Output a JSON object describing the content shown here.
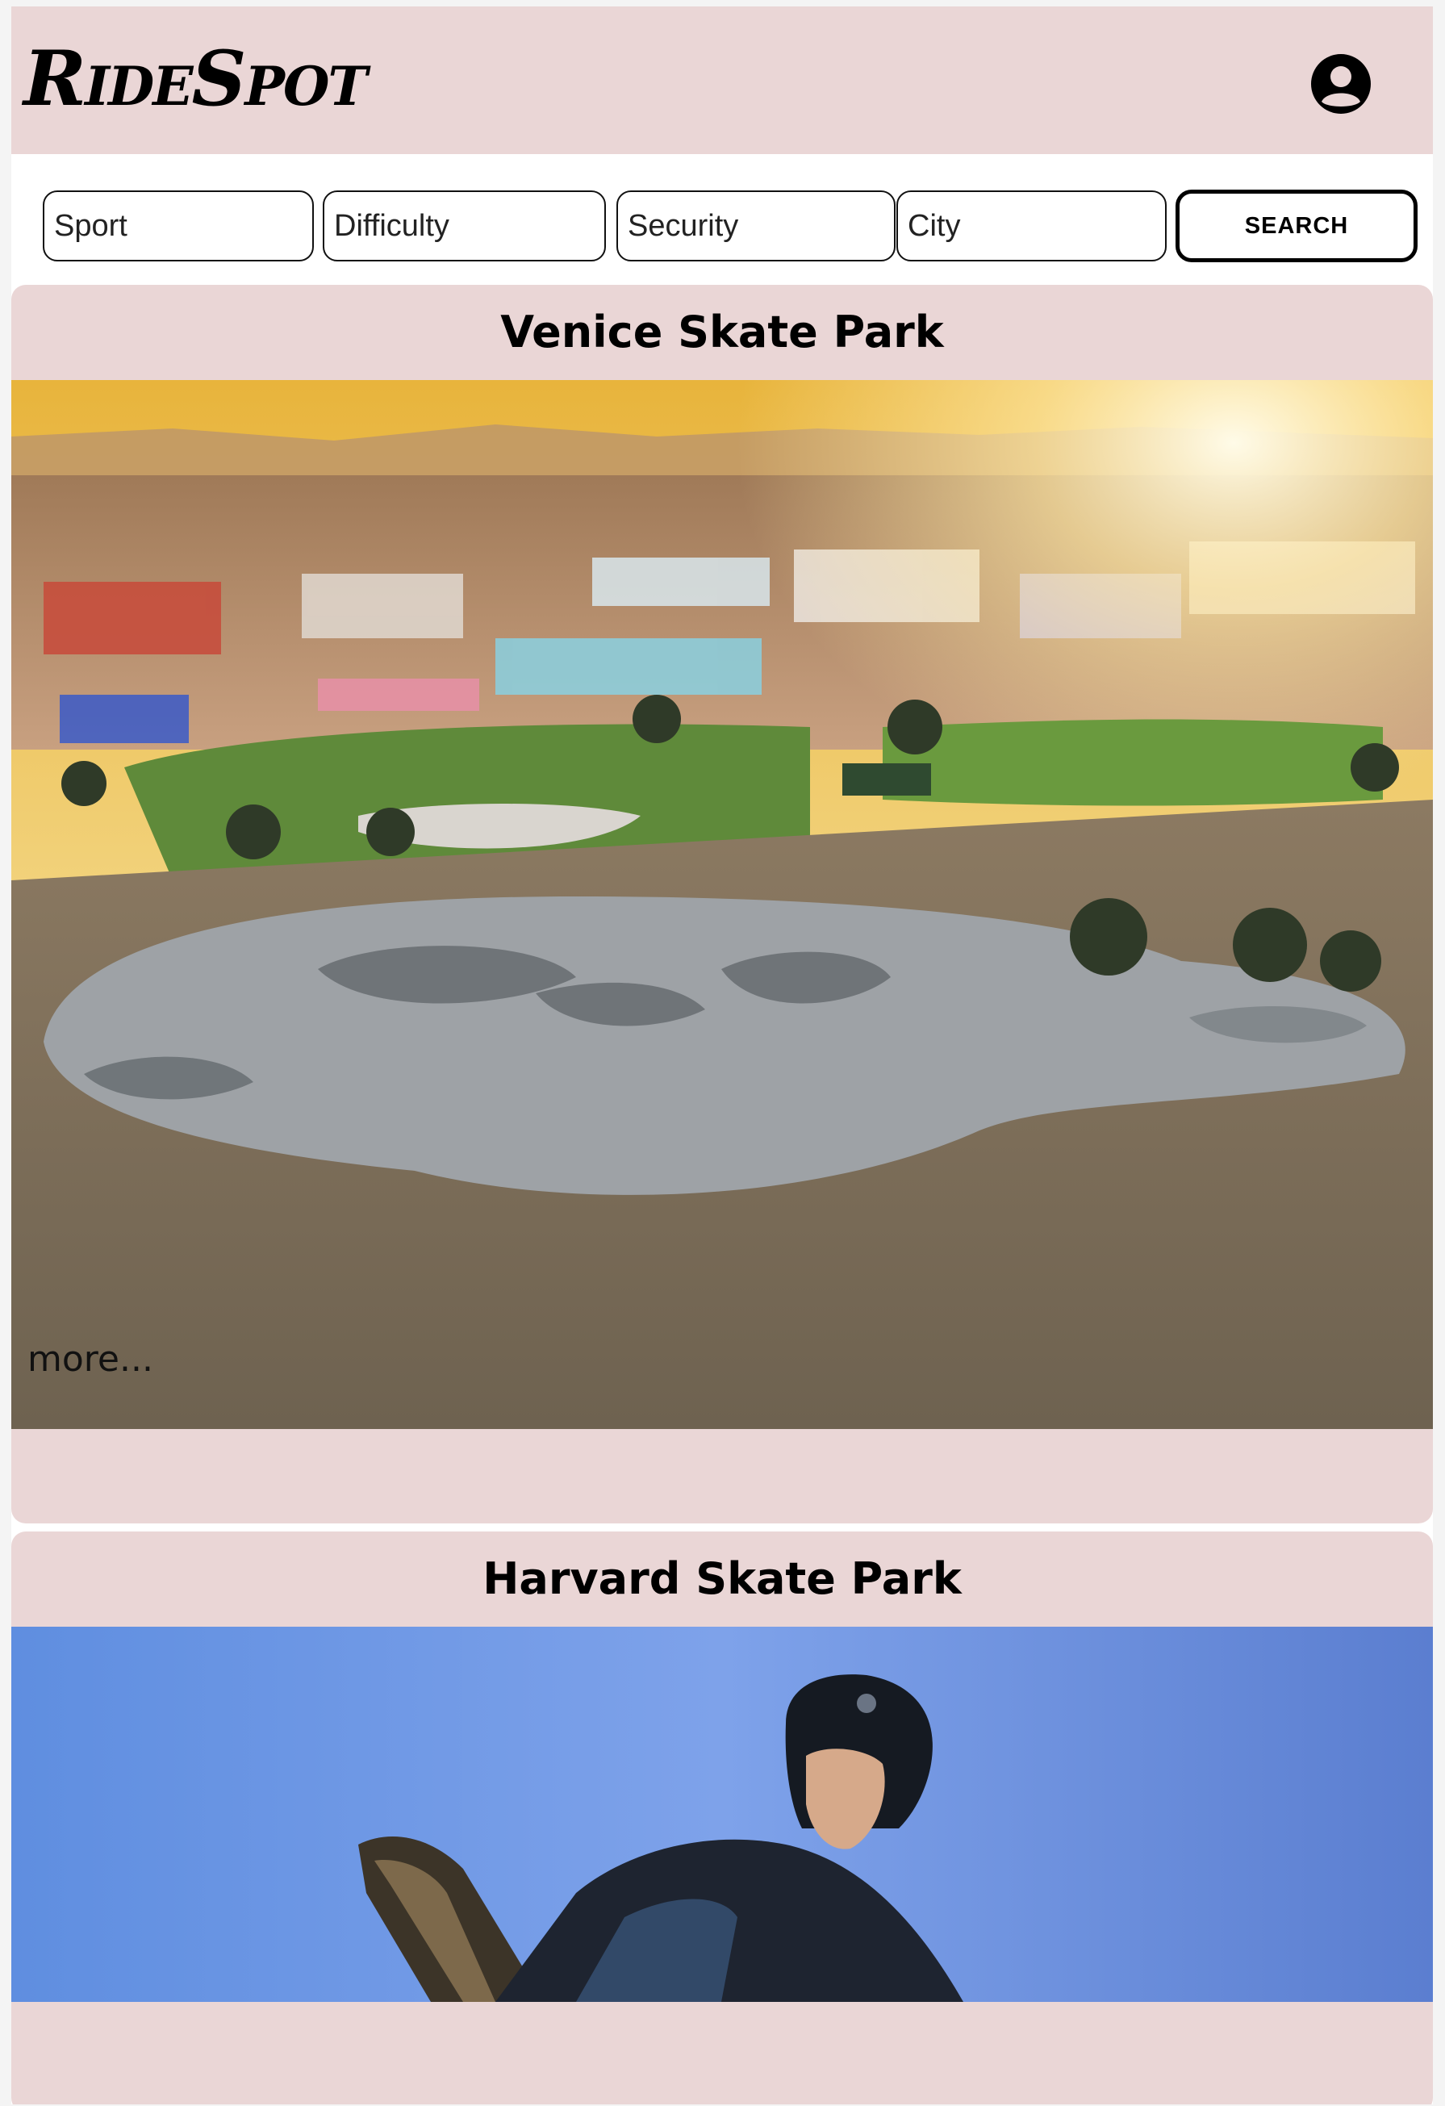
{
  "app": {
    "logo_text": "RideSpot"
  },
  "header": {
    "profile_icon": "user-circle-icon"
  },
  "filters": {
    "sport_placeholder": "Sport",
    "difficulty_placeholder": "Difficulty",
    "security_placeholder": "Security",
    "city_placeholder": "City",
    "search_label": "SEARCH"
  },
  "spots": [
    {
      "name": "Venice Skate Park",
      "more_label": "more..."
    },
    {
      "name": "Harvard Skate Park"
    }
  ],
  "colors": {
    "header_bg": "#ead6d6",
    "card_bg": "#ead6d6",
    "text": "#000000"
  }
}
